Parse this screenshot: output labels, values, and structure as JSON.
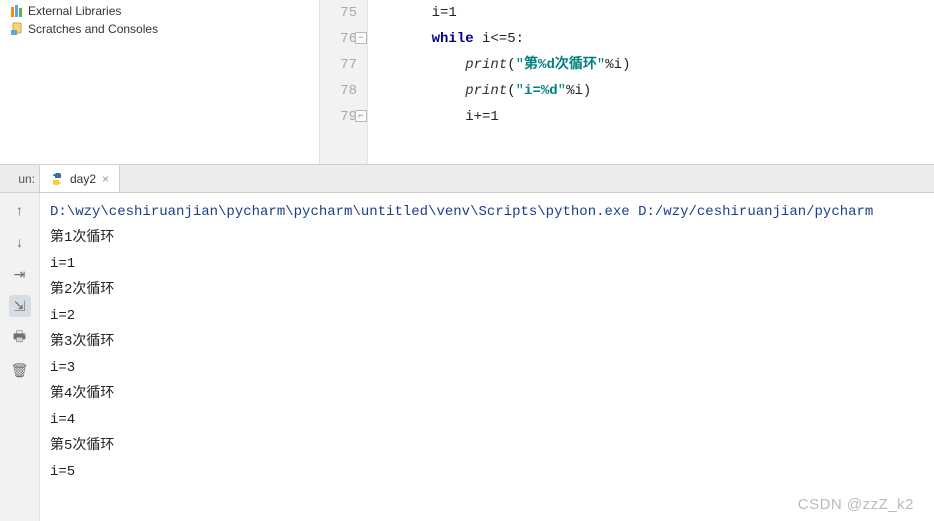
{
  "project_tree": {
    "items": [
      {
        "label": "External Libraries",
        "icon": "external-lib-icon"
      },
      {
        "label": "Scratches and Consoles",
        "icon": "scratch-icon"
      }
    ]
  },
  "editor": {
    "lines": [
      {
        "num": "75",
        "indent": 1,
        "tokens": [
          {
            "t": "plain",
            "v": "i=1"
          }
        ]
      },
      {
        "num": "76",
        "indent": 1,
        "fold": true,
        "tokens": [
          {
            "t": "kw",
            "v": "while"
          },
          {
            "t": "plain",
            "v": " i<=5:"
          }
        ]
      },
      {
        "num": "77",
        "indent": 2,
        "tokens": [
          {
            "t": "fn",
            "v": "print"
          },
          {
            "t": "plain",
            "v": "("
          },
          {
            "t": "str",
            "v": "\""
          },
          {
            "t": "strb",
            "v": "第%d次循环"
          },
          {
            "t": "str",
            "v": "\""
          },
          {
            "t": "plain",
            "v": "%i)"
          }
        ]
      },
      {
        "num": "78",
        "indent": 2,
        "tokens": [
          {
            "t": "fn",
            "v": "print"
          },
          {
            "t": "plain",
            "v": "("
          },
          {
            "t": "str",
            "v": "\""
          },
          {
            "t": "strb",
            "v": "i=%d"
          },
          {
            "t": "str",
            "v": "\""
          },
          {
            "t": "plain",
            "v": "%i)"
          }
        ]
      },
      {
        "num": "79",
        "indent": 2,
        "fold_end": true,
        "tokens": [
          {
            "t": "plain",
            "v": "i+=1"
          }
        ]
      }
    ]
  },
  "run_panel": {
    "label": "un:",
    "tab": {
      "name": "day2",
      "closable": true
    }
  },
  "toolbar": {
    "buttons": [
      {
        "name": "up-icon",
        "glyph": "↑"
      },
      {
        "name": "down-icon",
        "glyph": "↓"
      },
      {
        "name": "wrap-icon",
        "glyph": "⇥"
      },
      {
        "name": "scroll-icon",
        "glyph": "⇲",
        "active": true
      },
      {
        "name": "print-icon",
        "glyph": "🖶"
      },
      {
        "name": "trash-icon",
        "glyph": "🗑"
      }
    ]
  },
  "console": {
    "command": "D:\\wzy\\ceshiruanjian\\pycharm\\pycharm\\untitled\\venv\\Scripts\\python.exe D:/wzy/ceshiruanjian/pycharm",
    "output": [
      "第1次循环",
      "i=1",
      "第2次循环",
      "i=2",
      "第3次循环",
      "i=3",
      "第4次循环",
      "i=4",
      "第5次循环",
      "i=5"
    ]
  },
  "watermark": "CSDN @zzZ_k2"
}
